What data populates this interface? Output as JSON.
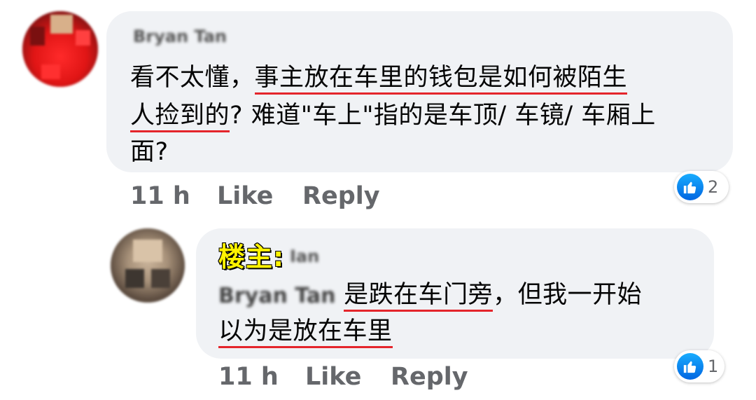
{
  "comment1": {
    "author": "Bryan Tan",
    "lines": {
      "l1a": "看不太懂，",
      "l1b": "事主放在车里的钱包是如何被陌生",
      "l2a": "人捡到的",
      "l2b": "? 难道\"车上\"指的是车顶/ 车镜/ 车厢上",
      "l3": "面?"
    },
    "meta": {
      "time": "11 h",
      "like": "Like",
      "reply": "Reply"
    },
    "reaction_count": "2",
    "reaction_icon": "like-icon"
  },
  "comment2": {
    "op_tag": "楼主:",
    "author_blur": "Ian",
    "mention": "Bryan Tan",
    "lines": {
      "l1a": "是跌在车门旁",
      "l1b": "，但我一开始",
      "l2": "以为是放在车里"
    },
    "meta": {
      "time": "11 h",
      "like": "Like",
      "reply": "Reply"
    },
    "reaction_count": "1",
    "reaction_icon": "like-icon"
  },
  "colors": {
    "bubble": "#f0f2f5",
    "underline": "#e4252b",
    "meta_text": "#65676b",
    "like_blue": "#0165e1",
    "op_tag": "#fff200"
  }
}
